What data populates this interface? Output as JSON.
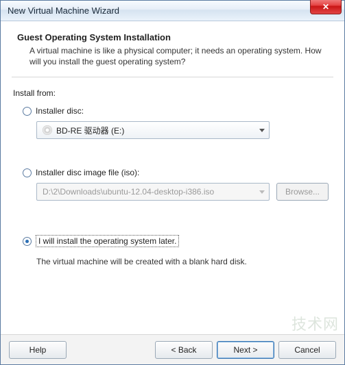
{
  "window": {
    "title": "New Virtual Machine Wizard"
  },
  "header": {
    "title": "Guest Operating System Installation",
    "desc": "A virtual machine is like a physical computer; it needs an operating system. How will you install the guest operating system?"
  },
  "install_label": "Install from:",
  "options": {
    "disc": {
      "label": "Installer disc:",
      "selected": false,
      "value": "BD-RE 驱动器 (E:)"
    },
    "iso": {
      "label": "Installer disc image file (iso):",
      "selected": false,
      "value": "D:\\2\\Downloads\\ubuntu-12.04-desktop-i386.iso",
      "browse": "Browse..."
    },
    "later": {
      "label": "I will install the operating system later.",
      "selected": true,
      "note": "The virtual machine will be created with a blank hard disk."
    }
  },
  "footer": {
    "help": "Help",
    "back": "< Back",
    "next": "Next >",
    "cancel": "Cancel"
  },
  "watermark": "技术网"
}
